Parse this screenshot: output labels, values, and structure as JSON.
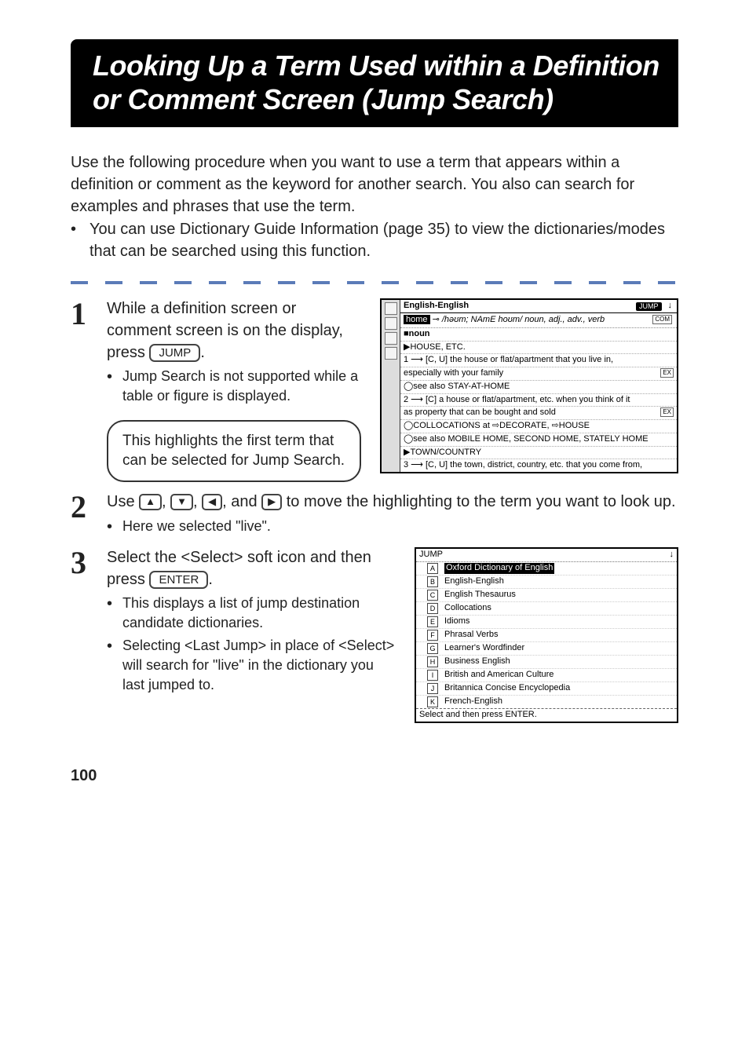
{
  "title": "Looking Up a Term Used within a Definition or Comment Screen (Jump Search)",
  "intro": "Use the following procedure when you want to use a term that appears within a definition or comment as the keyword for another search. You also can search for examples and phrases that use the term.",
  "intro_bullet": "You can use Dictionary Guide Information (page 35) to view the dictionaries/modes that can be searched using this function.",
  "steps": {
    "s1": {
      "num": "1",
      "text_a": "While a definition screen or comment screen is on the display, press ",
      "key": "JUMP",
      "text_b": ".",
      "sub": "Jump Search is not supported while a table or figure is displayed.",
      "callout": "This highlights the first term that can be selected for Jump Search."
    },
    "s2": {
      "num": "2",
      "text_a": "Use ",
      "k1": "▲",
      "k2": "▼",
      "k3": "◀",
      "k4": "▶",
      "text_b": ", and ",
      "text_c": " to move the highlighting to the term you want to look up.",
      "sub": "Here we selected \"live\"."
    },
    "s3": {
      "num": "3",
      "text_a": "Select the <Select> soft icon and then press ",
      "key": "ENTER",
      "text_b": ".",
      "sub1": "This displays a list of jump destination candidate dictionaries.",
      "sub2": "Selecting <Last Jump> in place of <Select> will search for \"live\" in the dictionary you last jumped to."
    }
  },
  "screen1": {
    "dict_label": "English-English",
    "badge": "JUMP",
    "headword": "home",
    "pron": "/həʊm; NAmE hoʊm/",
    "pos": "noun, adj., adv., verb",
    "com": "COM",
    "rows": [
      "■noun",
      "▶HOUSE, ETC.",
      "1 ⟶ [C, U] the house or flat/apartment that you live in,",
      "especially with your family",
      "◯see also STAY-AT-HOME",
      "2 ⟶ [C] a house or flat/apartment, etc. when you think of it",
      "as property that can be bought and sold",
      "◯COLLOCATIONS at ⇨DECORATE, ⇨HOUSE",
      "◯see also MOBILE HOME, SECOND HOME, STATELY HOME",
      "▶TOWN/COUNTRY",
      "3 ⟶ [C, U] the town, district, country, etc. that you come from,"
    ],
    "ex_tag": "EX"
  },
  "screen2": {
    "title": "JUMP",
    "items": [
      {
        "k": "A",
        "label": "Oxford Dictionary of English",
        "sel": true
      },
      {
        "k": "B",
        "label": "English-English",
        "sel": false
      },
      {
        "k": "C",
        "label": "English Thesaurus",
        "sel": false
      },
      {
        "k": "D",
        "label": "Collocations",
        "sel": false
      },
      {
        "k": "E",
        "label": "Idioms",
        "sel": false
      },
      {
        "k": "F",
        "label": "Phrasal Verbs",
        "sel": false
      },
      {
        "k": "G",
        "label": "Learner's Wordfinder",
        "sel": false
      },
      {
        "k": "H",
        "label": "Business English",
        "sel": false
      },
      {
        "k": "I",
        "label": "British and American Culture",
        "sel": false
      },
      {
        "k": "J",
        "label": "Britannica Concise Encyclopedia",
        "sel": false
      },
      {
        "k": "K",
        "label": "French-English",
        "sel": false
      }
    ],
    "footer": "Select and then press ENTER."
  },
  "page_number": "100"
}
